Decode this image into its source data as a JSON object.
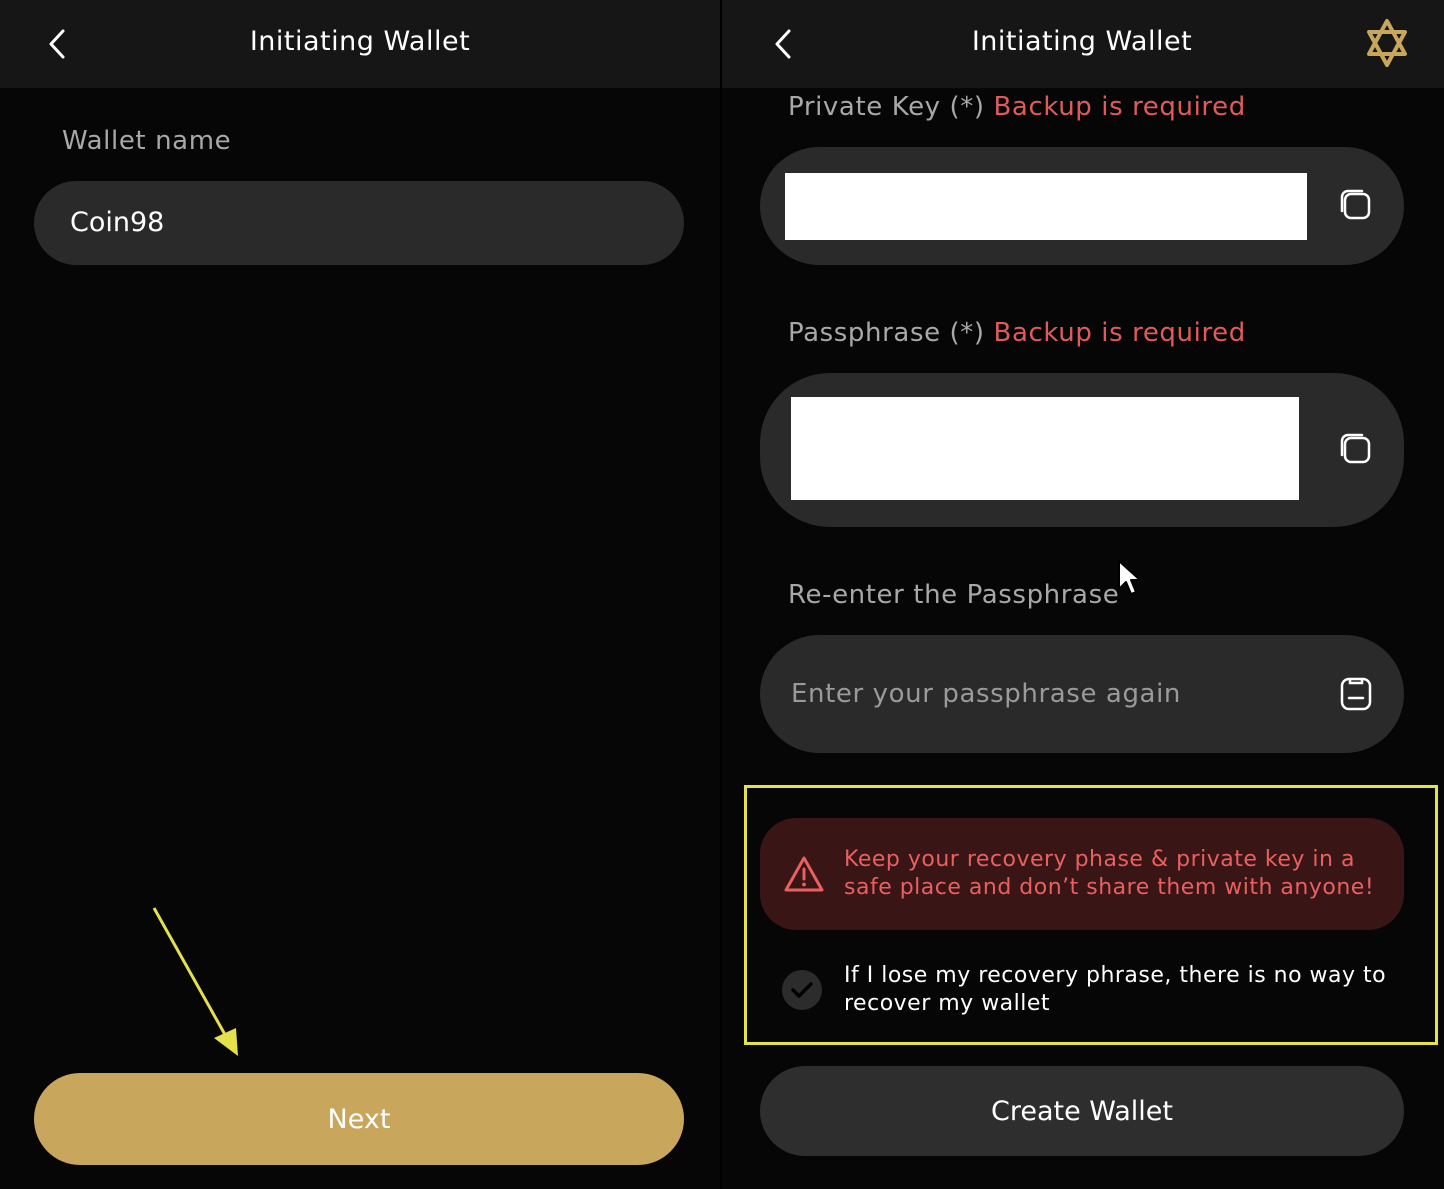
{
  "left": {
    "header": {
      "title": "Initiating Wallet"
    },
    "wallet_name": {
      "label": "Wallet name",
      "value": "Coin98"
    },
    "next_button": {
      "label": "Next"
    }
  },
  "right": {
    "header": {
      "title": "Initiating Wallet",
      "logo_icon": "coin98-star-logo"
    },
    "private_key": {
      "label": "Private Key (*)",
      "required_note": "Backup is required"
    },
    "passphrase": {
      "label": "Passphrase (*)",
      "required_note": "Backup is required"
    },
    "reenter": {
      "label": "Re-enter the Passphrase",
      "placeholder": "Enter your passphrase again"
    },
    "warning": {
      "text": "Keep your recovery phase & private key in a safe place and don’t share them with anyone!"
    },
    "acknowledge": {
      "text": "If I lose my recovery phrase, there is no way to recover my wallet"
    },
    "create_button": {
      "label": "Create Wallet"
    }
  },
  "colors": {
    "accent_gold": "#c8a65c",
    "error_red": "#e05a5a",
    "highlight_yellow": "#e6e04a",
    "field_bg": "#2a2a2a"
  }
}
